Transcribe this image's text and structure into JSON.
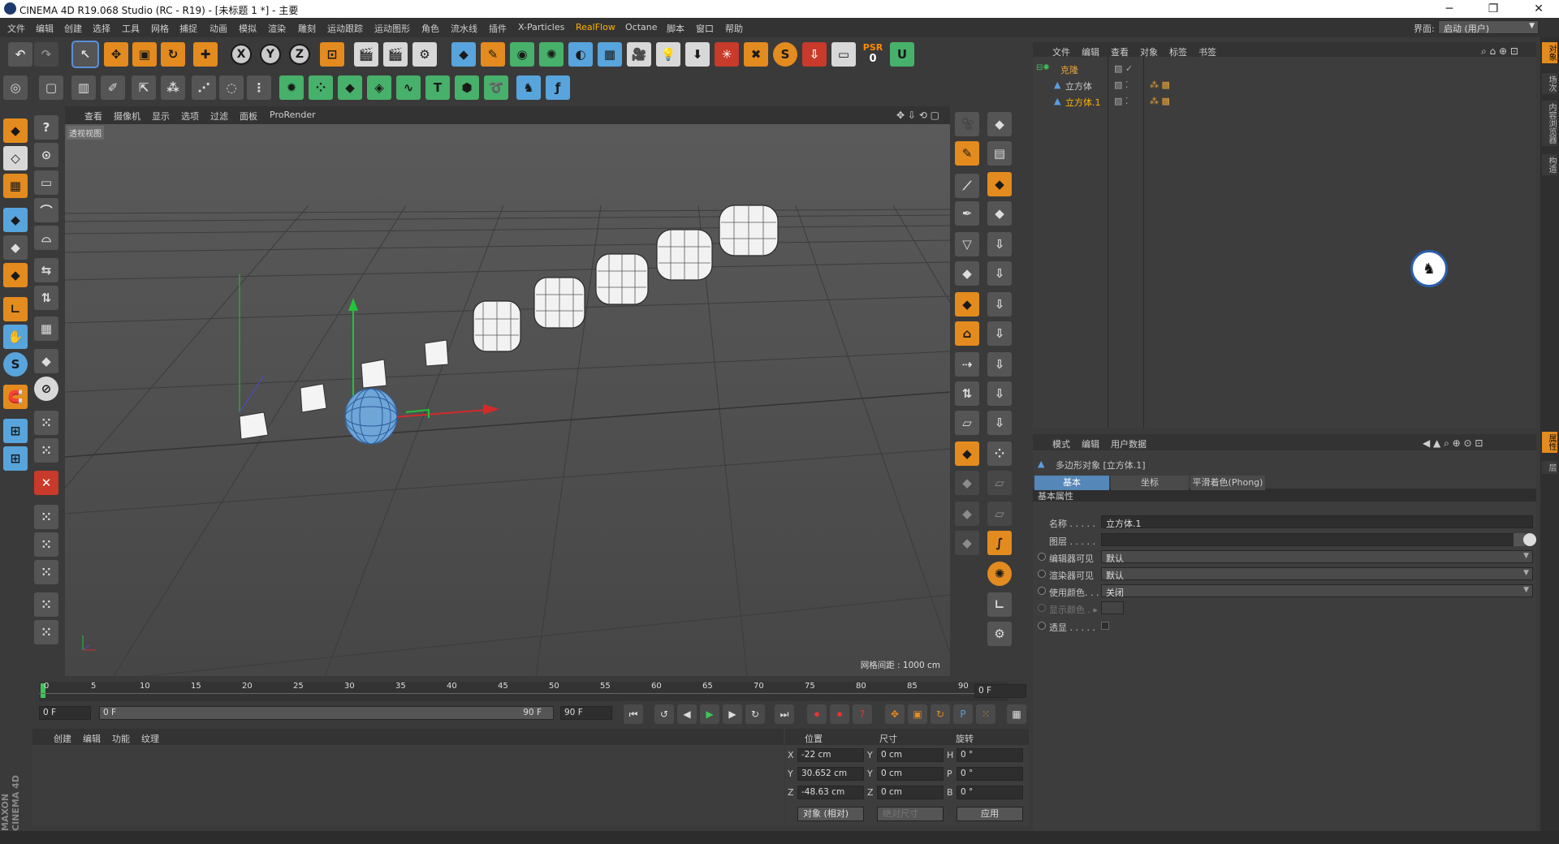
{
  "window": {
    "title": "CINEMA 4D R19.068 Studio (RC - R19) - [未标题 1 *] - 主要",
    "minimize": "─",
    "restore": "❐",
    "close": "✕"
  },
  "menubar": {
    "items": [
      "文件",
      "编辑",
      "创建",
      "选择",
      "工具",
      "网格",
      "捕捉",
      "动画",
      "模拟",
      "渲染",
      "雕刻",
      "运动跟踪",
      "运动图形",
      "角色",
      "流水线",
      "插件",
      "X-Particles",
      "RealFlow",
      "Octane",
      "脚本",
      "窗口",
      "帮助"
    ],
    "layout_label": "界面:",
    "layout_value": "启动 (用户)"
  },
  "toolbar": {
    "xyz": [
      "X",
      "Y",
      "Z"
    ],
    "psr_label": "PSR",
    "psr_value": "0"
  },
  "viewport": {
    "menu": [
      "查看",
      "摄像机",
      "显示",
      "选项",
      "过滤",
      "面板",
      "ProRender"
    ],
    "label": "透视视图",
    "grid_readout": "网格间距 : 1000 cm"
  },
  "timeline": {
    "ticks": [
      "0",
      "5",
      "10",
      "15",
      "20",
      "25",
      "30",
      "35",
      "40",
      "45",
      "50",
      "55",
      "60",
      "65",
      "70",
      "75",
      "80",
      "85",
      "90"
    ],
    "end_field": "0 F",
    "start_field": "0 F",
    "range_start": "0 F",
    "range_end": "90 F",
    "max_field": "90 F"
  },
  "object_manager": {
    "menu": [
      "文件",
      "编辑",
      "查看",
      "对象",
      "标签",
      "书签"
    ],
    "items": [
      {
        "name": "克隆",
        "color": "#e8a23a"
      },
      {
        "name": "立方体",
        "color": "#d8d8d8"
      },
      {
        "name": "立方体.1",
        "color": "#ffb300"
      }
    ]
  },
  "attribute_manager": {
    "menu": [
      "模式",
      "编辑",
      "用户数据"
    ],
    "object_title": "多边形对象 [立方体.1]",
    "tabs": [
      "基本",
      "坐标",
      "平滑着色(Phong)"
    ],
    "section": "基本属性",
    "props": [
      {
        "label": "名称 . . . . .",
        "value": "立方体.1",
        "type": "text"
      },
      {
        "label": "图层 . . . . .",
        "value": "",
        "type": "text"
      },
      {
        "label": "编辑器可见",
        "value": "默认",
        "type": "drop"
      },
      {
        "label": "渲染器可见",
        "value": "默认",
        "type": "drop"
      },
      {
        "label": "使用颜色. . .",
        "value": "关闭",
        "type": "drop"
      },
      {
        "label": "显示颜色 . ▸",
        "value": "",
        "type": "swatch"
      },
      {
        "label": "透显 . . . . .",
        "value": "",
        "type": "check"
      }
    ]
  },
  "material_manager": {
    "menu": [
      "创建",
      "编辑",
      "功能",
      "纹理"
    ]
  },
  "coordinates": {
    "headers": [
      "位置",
      "尺寸",
      "旋转"
    ],
    "rows": [
      {
        "axis": "X",
        "pos": "-22 cm",
        "size_axis": "Y",
        "size": "0 cm",
        "rot_axis": "H",
        "rot": "0 °"
      },
      {
        "axis": "Y",
        "pos": "30.652 cm",
        "size_axis": "Y",
        "size": "0 cm",
        "rot_axis": "P",
        "rot": "0 °"
      },
      {
        "axis": "Z",
        "pos": "-48.63 cm",
        "size_axis": "Z",
        "size": "0 cm",
        "rot_axis": "B",
        "rot": "0 °"
      }
    ],
    "mode": "对象 (相对)",
    "size_mode": "绝对尺寸",
    "apply": "应用"
  },
  "right_strip": [
    "对象",
    "场次",
    "内容浏览器",
    "构造",
    "属性",
    "层"
  ],
  "brand": "MAXON CINEMA 4D"
}
